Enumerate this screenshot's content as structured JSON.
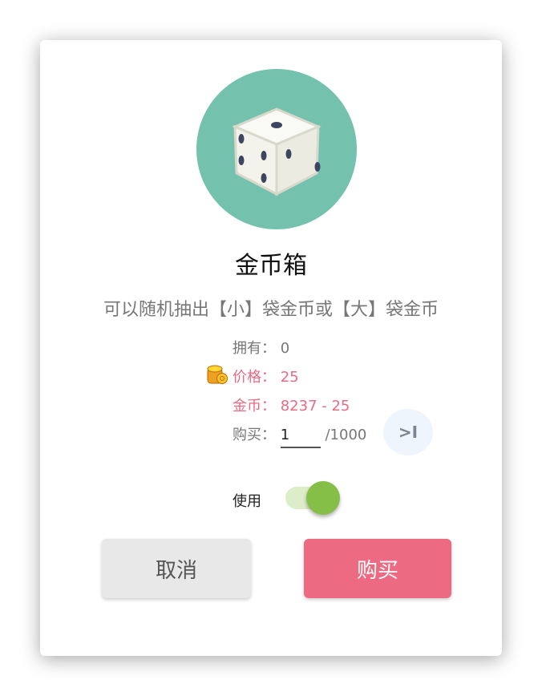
{
  "item": {
    "title": "金币箱",
    "description": "可以随机抽出【小】袋金币或【大】袋金币"
  },
  "info": {
    "owned_label": "拥有：",
    "owned_value": "0",
    "price_label": "价格：",
    "price_value": "25",
    "gold_label": "金币：",
    "gold_value": "8237 - 25",
    "buy_label": "购买：",
    "quantity": "1",
    "max": "/1000",
    "max_button": ">I"
  },
  "use": {
    "label": "使用",
    "enabled": true
  },
  "buttons": {
    "cancel": "取消",
    "buy": "购买"
  },
  "colors": {
    "accent": "#ec6a82",
    "toggle": "#86bf48",
    "icon_bg": "#74c2ad"
  }
}
